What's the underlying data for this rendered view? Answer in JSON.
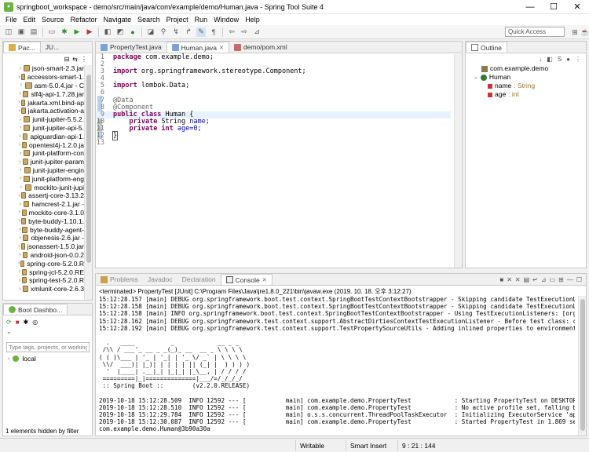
{
  "window": {
    "title": "springboot_workspace - demo/src/main/java/com/example/demo/Human.java - Spring Tool Suite 4",
    "min": "—",
    "max": "☐",
    "close": "✕"
  },
  "menu": [
    "File",
    "Edit",
    "Source",
    "Refactor",
    "Navigate",
    "Search",
    "Project",
    "Run",
    "Window",
    "Help"
  ],
  "toolbar": {
    "quick_access_placeholder": "Quick Access"
  },
  "package_explorer": {
    "tabs": [
      "Pac...",
      "JU..."
    ],
    "items": [
      "json-smart-2.3.jar",
      "accessors-smart-1.",
      "asm-5.0.4.jar - C",
      "slf4j-api-1.7.28.jar",
      "jakarta.xml.bind-ap",
      "jakarta.activation-a",
      "junit-jupiter-5.5.2.",
      "junit-jupiter-api-5.",
      "apiguardian-api-1.",
      "opentest4j-1.2.0.ja",
      "junit-platform-con",
      "junit-jupiter-param",
      "junit-jupiter-engin",
      "junit-platform-eng",
      "mockito-junit-jupi",
      "assertj-core-3.13.2",
      "hamcrest-2.1.jar -",
      "mockito-core-3.1.0",
      "byte-buddy-1.10.1.",
      "byte-buddy-agent-",
      "objenesis-2.6.jar -",
      "jsonassert-1.5.0.jar",
      "android-json-0.0.2",
      "spring-core-5.2.0.R",
      "spring-jcl-5.2.0.RE",
      "spring-test-5.2.0.R",
      "xmlunit-core-2.6.3"
    ]
  },
  "boot_dashboard": {
    "title": "Boot Dashbo...",
    "filter_placeholder": "Type tags, projects, or working s",
    "local_label": "local",
    "footer": "1 elements hidden by filter"
  },
  "editor": {
    "tabs": [
      "PropertyTest.java",
      "Human.java",
      "demo/pom.xml"
    ],
    "lines": [
      {
        "n": "1",
        "parts": [
          [
            "kw",
            "package"
          ],
          [
            "",
            "com.example.demo;"
          ]
        ]
      },
      {
        "n": "2",
        "parts": []
      },
      {
        "n": "3",
        "parts": [
          [
            "kw",
            "import"
          ],
          [
            "",
            "org.springframework.stereotype.Component;"
          ]
        ]
      },
      {
        "n": "4",
        "parts": []
      },
      {
        "n": "5",
        "parts": [
          [
            "kw",
            "import"
          ],
          [
            "",
            "lombok.Data;"
          ]
        ]
      },
      {
        "n": "6",
        "parts": []
      },
      {
        "n": "7",
        "parts": [
          [
            "ann",
            "@Data"
          ]
        ]
      },
      {
        "n": "8",
        "parts": [
          [
            "ann",
            "@Component"
          ]
        ]
      },
      {
        "n": "9",
        "parts": [
          [
            "kw",
            "public class"
          ],
          [
            "",
            "Human {"
          ]
        ],
        "hl": true
      },
      {
        "n": "10",
        "parts": [
          [
            "",
            "    "
          ],
          [
            "kw",
            "private"
          ],
          [
            "",
            "String"
          ],
          [
            "fld",
            "name;"
          ]
        ]
      },
      {
        "n": "11",
        "parts": [
          [
            "",
            "    "
          ],
          [
            "kw",
            "private int"
          ],
          [
            "fld",
            "age=0;"
          ]
        ]
      },
      {
        "n": "12",
        "parts": [
          [
            "",
            "}"
          ]
        ]
      },
      {
        "n": "13",
        "parts": []
      }
    ]
  },
  "outline": {
    "title": "Outline",
    "package": "com.example.demo",
    "class": "Human",
    "fields": [
      {
        "name": "name",
        "type": " : String"
      },
      {
        "name": "age",
        "type": " : int"
      }
    ]
  },
  "console": {
    "tabs": [
      "Problems",
      "Javadoc",
      "Declaration",
      "Console"
    ],
    "header": "<terminated> PropertyTest [JUnit] C:\\Program Files\\Java\\jre1.8.0_221\\bin\\javaw.exe (2019. 10. 18. 오후 3:12:27)",
    "lines": [
      "15:12:28.157 [main] DEBUG org.springframework.boot.test.context.SpringBootTestContextBootstrapper - Skipping candidate TestExecutionListener [or",
      "15:12:28.158 [main] DEBUG org.springframework.boot.test.context.SpringBootTestContextBootstrapper - Skipping candidate TestExecutionListener [or",
      "15:12:28.158 [main] INFO org.springframework.boot.test.context.SpringBootTestContextBootstrapper - Using TestExecutionListeners: [org.springframe",
      "15:12:28.162 [main] DEBUG org.springframework.test.context.support.AbstractDirtiesContextTestExecutionListener - Before test class: context [Def",
      "15:12:28.192 [main] DEBUG org.springframework.test.context.support.TestPropertySourceUtils - Adding inlined properties to environment: {spring.j",
      "",
      "  .   ____          _            __ _ _",
      " /\\\\ / ___'_ __ _ _(_)_ __  __ _ \\ \\ \\ \\",
      "( ( )\\___ | '_ | '_| | '_ \\/ _` | \\ \\ \\ \\",
      " \\\\/  ___)| |_)| | | | | || (_| |  ) ) ) )",
      "  '  |____| .__|_| |_|_| |_\\__, | / / / /",
      " =========|_|==============|___/=/_/_/_/",
      " :: Spring Boot ::        (v2.2.0.RELEASE)",
      "",
      "2019-10-18 15:12:28.509  INFO 12592 --- [           main] com.example.demo.PropertyTest            : Starting PropertyTest on DESKTOP-IUR84JP wi",
      "2019-10-18 15:12:28.510  INFO 12592 --- [           main] com.example.demo.PropertyTest            : No active profile set, falling back to defa",
      "2019-10-18 15:12:29.784  INFO 12592 --- [           main] o.s.s.concurrent.ThreadPoolTaskExecutor  : Initializing ExecutorService 'applicationTa",
      "2019-10-18 15:12:30.087  INFO 12592 --- [           main] com.example.demo.PropertyTest            : Started PropertyTest in 1.869 seconds (JVM",
      "com.example.demo.Human@3b90a30a"
    ]
  },
  "status": {
    "writable": "Writable",
    "insert": "Smart Insert",
    "position": "9 : 21 : 144"
  }
}
